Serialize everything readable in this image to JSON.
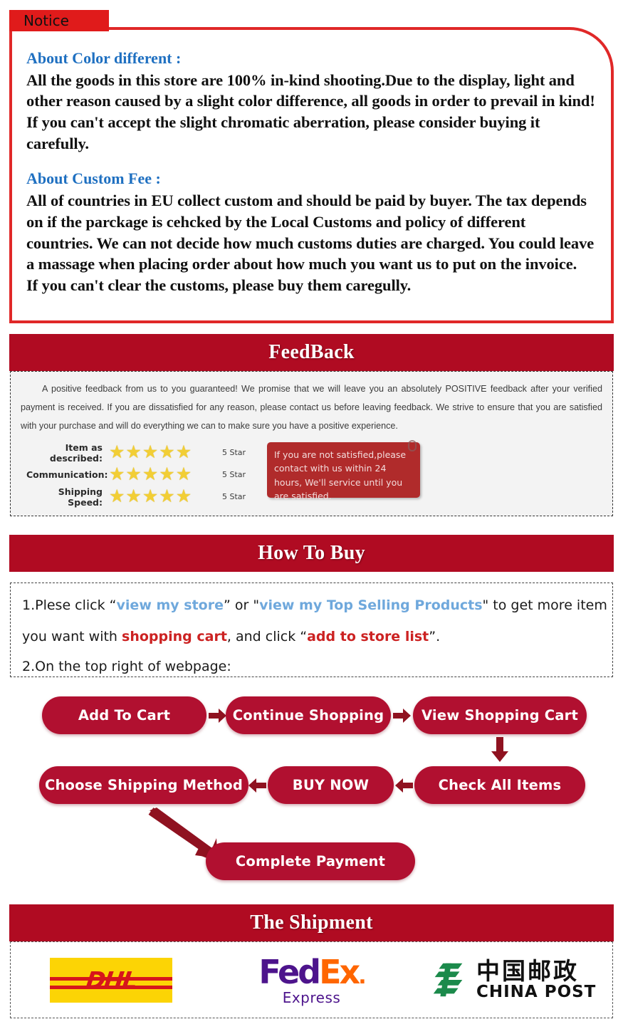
{
  "notice": {
    "tab_label": "Notice",
    "color_heading": "About Color different :",
    "color_body": "All the goods in this store are 100% in-kind shooting.Due to the display, light and other reason caused by a slight color difference, all goods in order to prevail in kind! If you can't accept the slight chromatic aberration, please consider buying it carefully.",
    "custom_heading": "About Custom Fee :",
    "custom_body": "All of countries in EU collect custom and should be paid by buyer.  The tax depends on if the parckage is cehcked by the Local Customs and policy of different countries. We can not decide how much customs duties are charged. You could leave a massage when placing order about how much you want us to put on the invoice.",
    "custom_body2": "If you can't clear the customs, please buy them caregully."
  },
  "feedback": {
    "banner_title": "FeedBack",
    "paragraph": "A positive feedback from us to you guaranteed! We promise that we will leave you an absolutely POSITIVE feedback after your verified payment is received. If you are dissatisfied for any reason, please contact us before leaving feedback. We strive to ensure that you are satisfied with your purchase and will do everything we can to make sure you have a positive experience.",
    "ratings": [
      {
        "label": "Item as described:",
        "stars": 5,
        "count": "5 Star"
      },
      {
        "label": "Communication:",
        "stars": 5,
        "count": "5 Star"
      },
      {
        "label": "Shipping Speed:",
        "stars": 5,
        "count": "5 Star"
      }
    ],
    "callout": "If you are not satisfied,please contact with us within 24 hours, We'll service until you are satisfied."
  },
  "how_to_buy": {
    "banner_title": "How To Buy",
    "step1_a": "1.Plese click “",
    "step1_link1": "view my store",
    "step1_b": "” or \"",
    "step1_link2": "view my Top Selling Products",
    "step1_c": "\" to get more item",
    "step2_a": "you want with ",
    "step2_hl1": "shopping cart",
    "step2_b": ", and click “",
    "step2_hl2": "add to store list",
    "step2_c": "”.",
    "step3": "2.On the top right of webpage:",
    "flow": [
      {
        "label": "Add To Cart"
      },
      {
        "label": "Continue Shopping"
      },
      {
        "label": "View Shopping Cart"
      },
      {
        "label": "Check All Items"
      },
      {
        "label": "BUY NOW"
      },
      {
        "label": "Choose Shipping Method"
      },
      {
        "label": "Complete Payment"
      }
    ]
  },
  "shipment": {
    "banner_title": "The Shipment",
    "carriers": [
      {
        "name": "DHL",
        "text": "DHL"
      },
      {
        "name": "FedEx",
        "main_a": "Fed",
        "main_b": "Ex",
        "dot": ".",
        "sub": "Express"
      },
      {
        "name": "China Post",
        "cn": "中国邮政",
        "en": "CHINA POST"
      }
    ]
  },
  "colors": {
    "notice_border": "#e02828",
    "banner_red": "#b00b22",
    "pill_red": "#b11030",
    "arrow_red": "#8f1220",
    "heading_blue": "#1f70c1",
    "star_gold": "#f2ce35",
    "dhl_yellow": "#fcd405",
    "dhl_red": "#d6161b",
    "fedex_purple": "#4d148c",
    "fedex_orange": "#ff6600",
    "chinapost_green": "#1b8a4b"
  }
}
